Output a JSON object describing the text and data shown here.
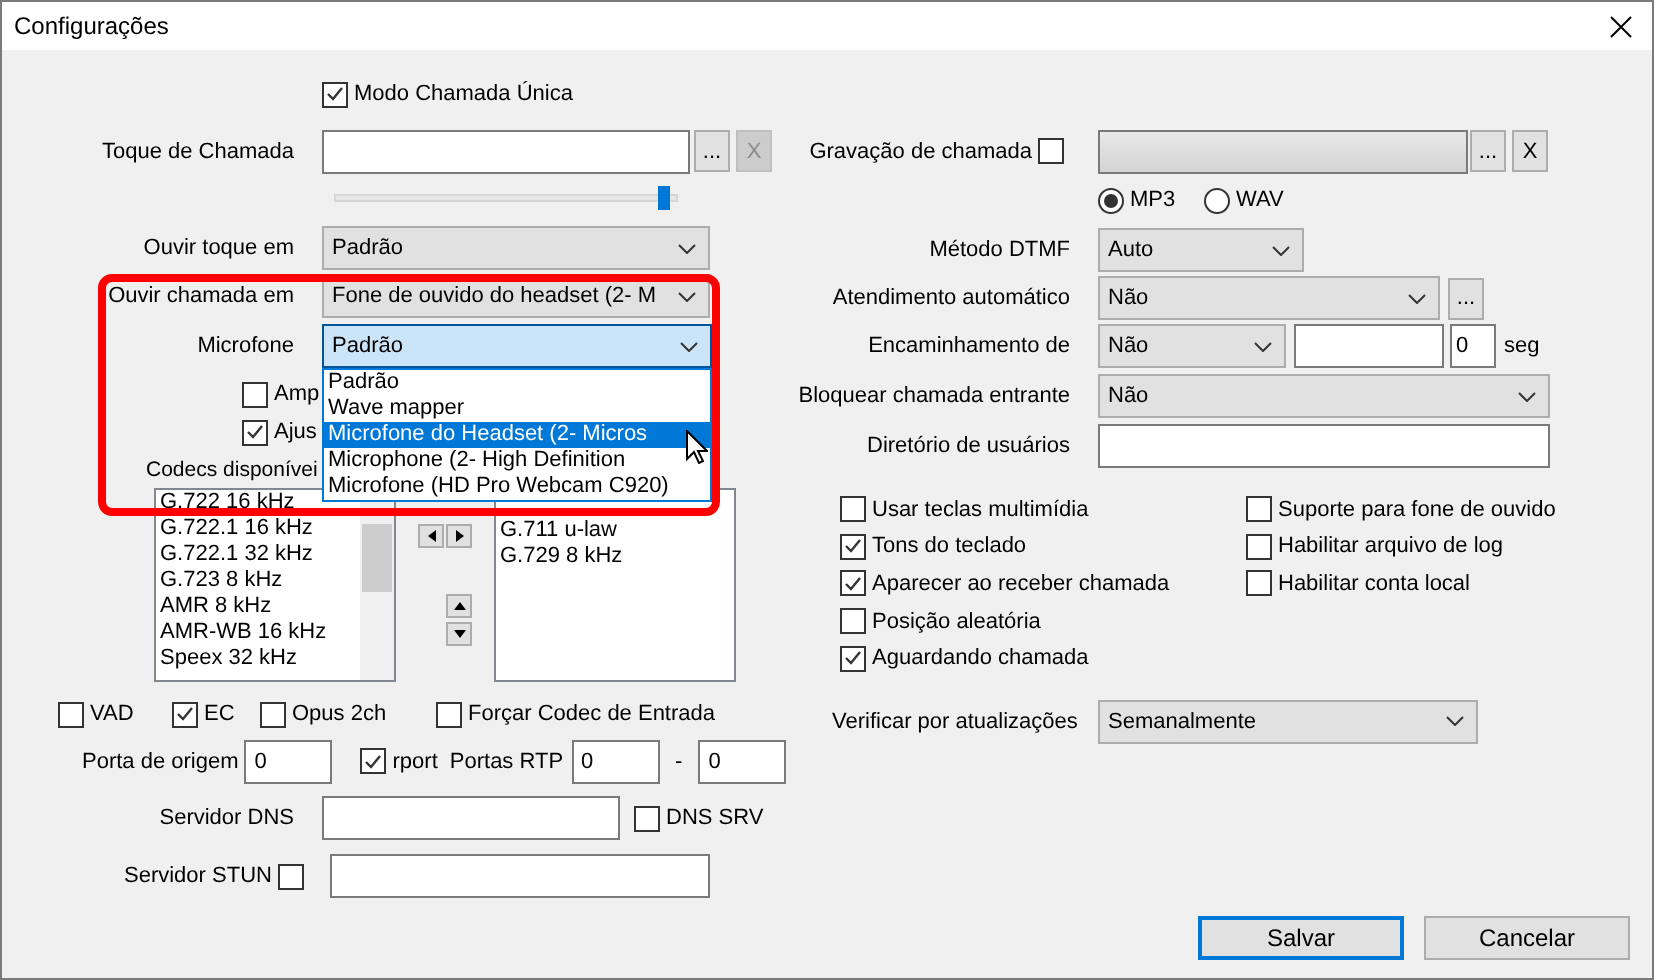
{
  "window": {
    "title": "Configurações"
  },
  "left": {
    "single_call_mode": {
      "label": "Modo Chamada Única",
      "checked": true
    },
    "ringtone": {
      "label": "Toque de Chamada",
      "browse": "...",
      "clear": "X",
      "clear_disabled": true,
      "volume": {
        "level": 0.98
      }
    },
    "ring_device": {
      "label": "Ouvir toque em",
      "value": "Padrão"
    },
    "call_device": {
      "label": "Ouvir chamada em",
      "value": "Fone de ouvido do headset (2- M"
    },
    "microphone": {
      "label": "Microfone",
      "value": "Padrão",
      "expanded": true,
      "options": [
        {
          "label": "Padrão",
          "highlighted": false
        },
        {
          "label": "Wave mapper",
          "highlighted": false
        },
        {
          "label": "Microfone do Headset (2- Micros",
          "highlighted": true
        },
        {
          "label": "Microphone (2- High Definition",
          "highlighted": false
        },
        {
          "label": "Microfone (HD Pro Webcam C920)",
          "highlighted": false
        }
      ]
    },
    "mic_checks": [
      {
        "label": "Amp",
        "checked": false
      },
      {
        "label": "Ajus",
        "checked": true
      }
    ],
    "codecs": {
      "label": "Codecs disponívei",
      "available": [
        "G.722 16 kHz",
        "G.722.1 16 kHz",
        "G.722.1 32 kHz",
        "G.723 8 kHz",
        "AMR 8 kHz",
        "AMR-WB 16 kHz",
        "Speex 32 kHz"
      ],
      "enabled": [
        "G.711 u-law",
        "G.729 8 kHz"
      ]
    },
    "options": [
      {
        "label": "VAD",
        "checked": false
      },
      {
        "label": "EC",
        "checked": true
      },
      {
        "label": "Opus 2ch",
        "checked": false
      },
      {
        "label": "Forçar Codec de Entrada",
        "checked": false
      }
    ],
    "source_port": {
      "label": "Porta de origem",
      "value": "0"
    },
    "rport": {
      "label": "rport",
      "checked": true
    },
    "rtp_ports": {
      "label": "Portas RTP",
      "from": "0",
      "separator": "-",
      "to": "0"
    },
    "dns_server": {
      "label": "Servidor DNS"
    },
    "dns_srv": {
      "label": "DNS SRV",
      "checked": false
    },
    "stun_server": {
      "label": "Servidor STUN",
      "checked": false
    }
  },
  "right": {
    "recording": {
      "label": "Gravação de chamada",
      "checked": false,
      "browse": "...",
      "clear": "X",
      "formats": [
        {
          "label": "MP3",
          "selected": true
        },
        {
          "label": "WAV",
          "selected": false
        }
      ]
    },
    "dtmf": {
      "label": "Método DTMF",
      "value": "Auto"
    },
    "auto_answer": {
      "label": "Atendimento automático",
      "value": "Não",
      "more": "..."
    },
    "forwarding": {
      "label": "Encaminhamento de",
      "value": "Não",
      "delay": "0",
      "unit": "seg"
    },
    "block_incoming": {
      "label": "Bloquear chamada entrante",
      "value": "Não"
    },
    "user_directory": {
      "label": "Diretório de usuários"
    },
    "options_left": [
      {
        "label": "Usar teclas multimídia",
        "checked": false
      },
      {
        "label": "Tons do teclado",
        "checked": true
      },
      {
        "label": "Aparecer ao receber chamada",
        "checked": true
      },
      {
        "label": "Posição aleatória",
        "checked": false
      },
      {
        "label": "Aguardando chamada",
        "checked": true
      }
    ],
    "options_right": [
      {
        "label": "Suporte para fone de ouvido",
        "checked": false
      },
      {
        "label": "Habilitar arquivo de log",
        "checked": false
      },
      {
        "label": "Habilitar conta local",
        "checked": false
      }
    ],
    "updates": {
      "label": "Verificar por atualizações",
      "value": "Semanalmente"
    }
  },
  "buttons": [
    {
      "label": "Salvar",
      "focused": true
    },
    {
      "label": "Cancelar",
      "focused": false
    }
  ]
}
